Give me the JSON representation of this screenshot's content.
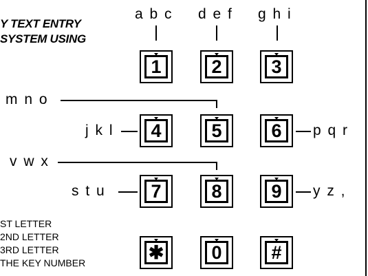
{
  "title": {
    "line1": "Y TEXT ENTRY",
    "line2": "SYSTEM USING"
  },
  "letters": {
    "abc": "a b c",
    "def": "d e f",
    "ghi": "g h i",
    "mno": "m n o",
    "jkl": "j k l",
    "pqr": "p q r",
    "vwx": "v w x",
    "stu": "s t u",
    "yz": "y z ,"
  },
  "keys": {
    "k1": "1",
    "k2": "2",
    "k3": "3",
    "k4": "4",
    "k5": "5",
    "k6": "6",
    "k7": "7",
    "k8": "8",
    "k9": "9",
    "kstar": "✱",
    "k0": "0",
    "khash": "#"
  },
  "legend": {
    "l1": "ST LETTER",
    "l2": "2ND LETTER",
    "l3": "3RD LETTER",
    "l4": "THE KEY NUMBER"
  }
}
